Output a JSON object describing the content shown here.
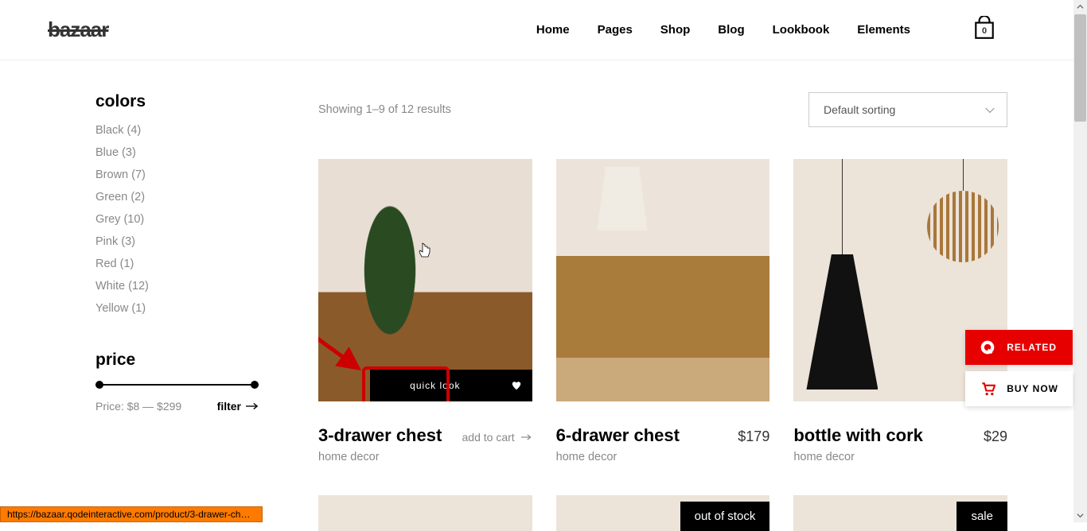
{
  "header": {
    "logo": "bazaar",
    "nav": [
      "Home",
      "Pages",
      "Shop",
      "Blog",
      "Lookbook",
      "Elements"
    ],
    "cart_count": "0"
  },
  "sidebar": {
    "colors_title": "colors",
    "colors": [
      {
        "label": "Black (4)"
      },
      {
        "label": "Blue (3)"
      },
      {
        "label": "Brown (7)"
      },
      {
        "label": "Green (2)"
      },
      {
        "label": "Grey (10)"
      },
      {
        "label": "Pink (3)"
      },
      {
        "label": "Red (1)"
      },
      {
        "label": "White (12)"
      },
      {
        "label": "Yellow (1)"
      }
    ],
    "price_title": "price",
    "price_text": "Price: $8 — $299",
    "filter_label": "filter"
  },
  "main": {
    "result_count": "Showing 1–9 of 12 results",
    "sort_value": "Default sorting",
    "products": [
      {
        "title": "3-drawer chest",
        "category": "home decor",
        "price": "",
        "add_label": "add to cart",
        "quick_look": "quick look"
      },
      {
        "title": "6-drawer chest",
        "category": "home decor",
        "price": "$179"
      },
      {
        "title": "bottle with cork",
        "category": "home decor",
        "price": "$29"
      }
    ],
    "row2": [
      {
        "badge": ""
      },
      {
        "badge": "out of stock"
      },
      {
        "badge": "sale"
      }
    ]
  },
  "floating": {
    "related": "RELATED",
    "buy_now": "BUY NOW"
  },
  "status_url": "https://bazaar.qodeinteractive.com/product/3-drawer-chest/"
}
